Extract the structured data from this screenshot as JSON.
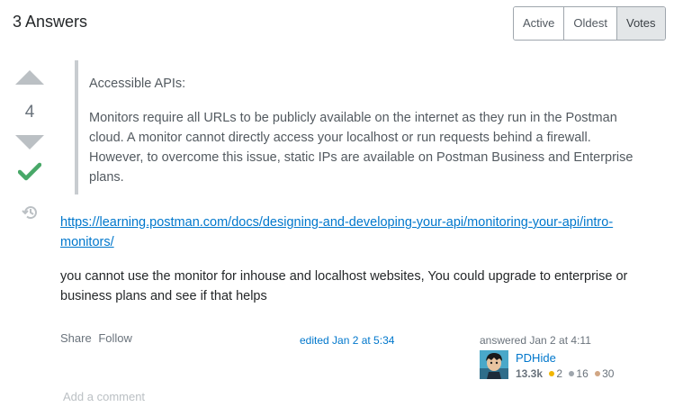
{
  "header": {
    "answers_title": "3 Answers"
  },
  "sort": {
    "options": [
      "Active",
      "Oldest",
      "Votes"
    ],
    "selected": "Votes"
  },
  "answer": {
    "vote_count": "4",
    "accepted": true,
    "quote_title": "Accessible APIs:",
    "quote_body": "Monitors require all URLs to be publicly available on the internet as they run in the Postman cloud. A monitor cannot directly access your localhost or run requests behind a firewall. However, to overcome this issue, static IPs are available on Postman Business and Enterprise plans.",
    "link_text": "https://learning.postman.com/docs/designing-and-developing-your-api/monitoring-your-api/intro-monitors/",
    "body": "you cannot use the monitor for inhouse and localhost websites, You could upgrade to enterprise or business plans and see if that helps",
    "share_label": "Share",
    "follow_label": "Follow",
    "edited": "edited Jan 2 at 5:34",
    "answered": "answered Jan 2 at 4:11",
    "user": {
      "name": "PDHide",
      "reputation": "13.3k",
      "gold": "2",
      "silver": "16",
      "bronze": "30"
    },
    "add_comment": "Add a comment"
  },
  "colors": {
    "accepted": "#48a868",
    "link": "#0077cc",
    "gold": "#f1b600",
    "silver": "#9fa6ad",
    "bronze": "#d1a684"
  }
}
